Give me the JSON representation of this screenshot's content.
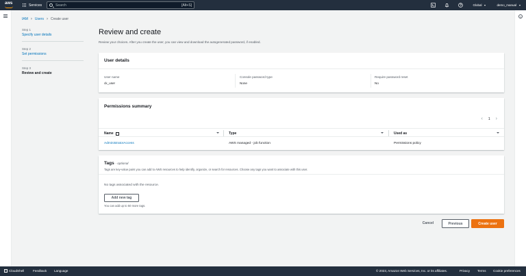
{
  "topbar": {
    "logo": "aws",
    "services_label": "Services",
    "search_placeholder": "Search",
    "search_shortcut": "[Alt+S]",
    "region": "Global",
    "account": "demo_manual",
    "icons": [
      "cloudshell-icon",
      "bell-icon",
      "help-icon"
    ]
  },
  "breadcrumb": [
    {
      "label": "IAM"
    },
    {
      "label": "Users"
    },
    {
      "label": "Create user"
    }
  ],
  "steps": [
    {
      "num": "Step 1",
      "label": "Specify user details"
    },
    {
      "num": "Step 2",
      "label": "Set permissions"
    },
    {
      "num": "Step 3",
      "label": "Review and create"
    }
  ],
  "page": {
    "title": "Review and create",
    "subtitle": "Review your choices. After you create the user, you can view and download the autogenerated password, if enabled."
  },
  "user_details": {
    "heading": "User details",
    "fields": [
      {
        "key": "User name",
        "value": "ck_user"
      },
      {
        "key": "Console password type",
        "value": "None"
      },
      {
        "key": "Require password reset",
        "value": "No"
      }
    ]
  },
  "permissions": {
    "heading": "Permissions summary",
    "page": "1",
    "columns": [
      "Name",
      "Type",
      "Used as"
    ],
    "rows": [
      {
        "name": "AdministratorAccess",
        "type": "AWS managed - job function",
        "used_as": "Permissions policy"
      }
    ]
  },
  "tags": {
    "heading": "Tags",
    "optional": "- optional",
    "description": "Tags are key-value pairs you can add to AWS resources to help identify, organize, or search for resources. Choose any tags you want to associate with this user.",
    "empty": "No tags associated with the resource.",
    "add_button": "Add new tag",
    "limit": "You can add up to 50 more tags."
  },
  "actions": {
    "cancel": "Cancel",
    "previous": "Previous",
    "create": "Create user"
  },
  "footer": {
    "cloudshell": "CloudShell",
    "feedback": "Feedback",
    "language": "Language",
    "copyright": "© 2023, Amazon Web Services, Inc. or its affiliates.",
    "privacy": "Privacy",
    "terms": "Terms",
    "cookies": "Cookie preferences"
  },
  "colors": {
    "nav": "#232f3e",
    "link": "#0073bb",
    "primary": "#ec7211"
  }
}
